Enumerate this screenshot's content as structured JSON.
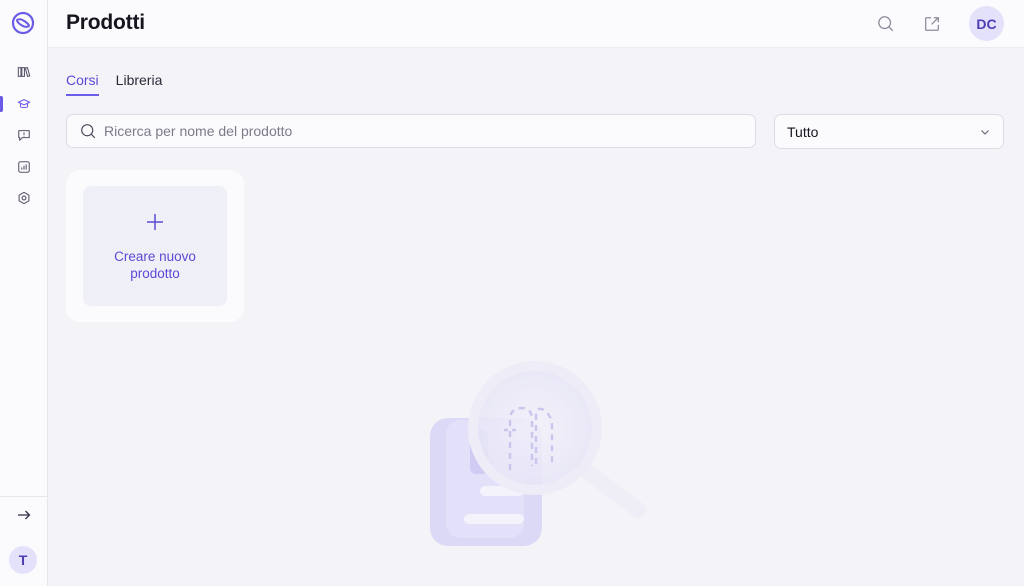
{
  "app": {
    "title": "Prodotti"
  },
  "sidebar": {
    "items": [
      {
        "name": "library-icon"
      },
      {
        "name": "courses-icon",
        "active": true
      },
      {
        "name": "chat-icon"
      },
      {
        "name": "analytics-icon"
      },
      {
        "name": "settings-icon"
      }
    ],
    "collapse_icon": "arrow-right-icon",
    "user_initial": "T"
  },
  "header": {
    "title": "Prodotti",
    "avatar_initials": "DC"
  },
  "tabs": [
    {
      "label": "Corsi",
      "active": true
    },
    {
      "label": "Libreria",
      "active": false
    }
  ],
  "search": {
    "placeholder": "Ricerca per nome del prodotto",
    "value": ""
  },
  "filter": {
    "selected": "Tutto"
  },
  "create_card": {
    "label": "Creare nuovo prodotto"
  },
  "colors": {
    "accent": "#6b5ce7",
    "background": "#f4f4f8",
    "panel": "#fbfbfd"
  }
}
